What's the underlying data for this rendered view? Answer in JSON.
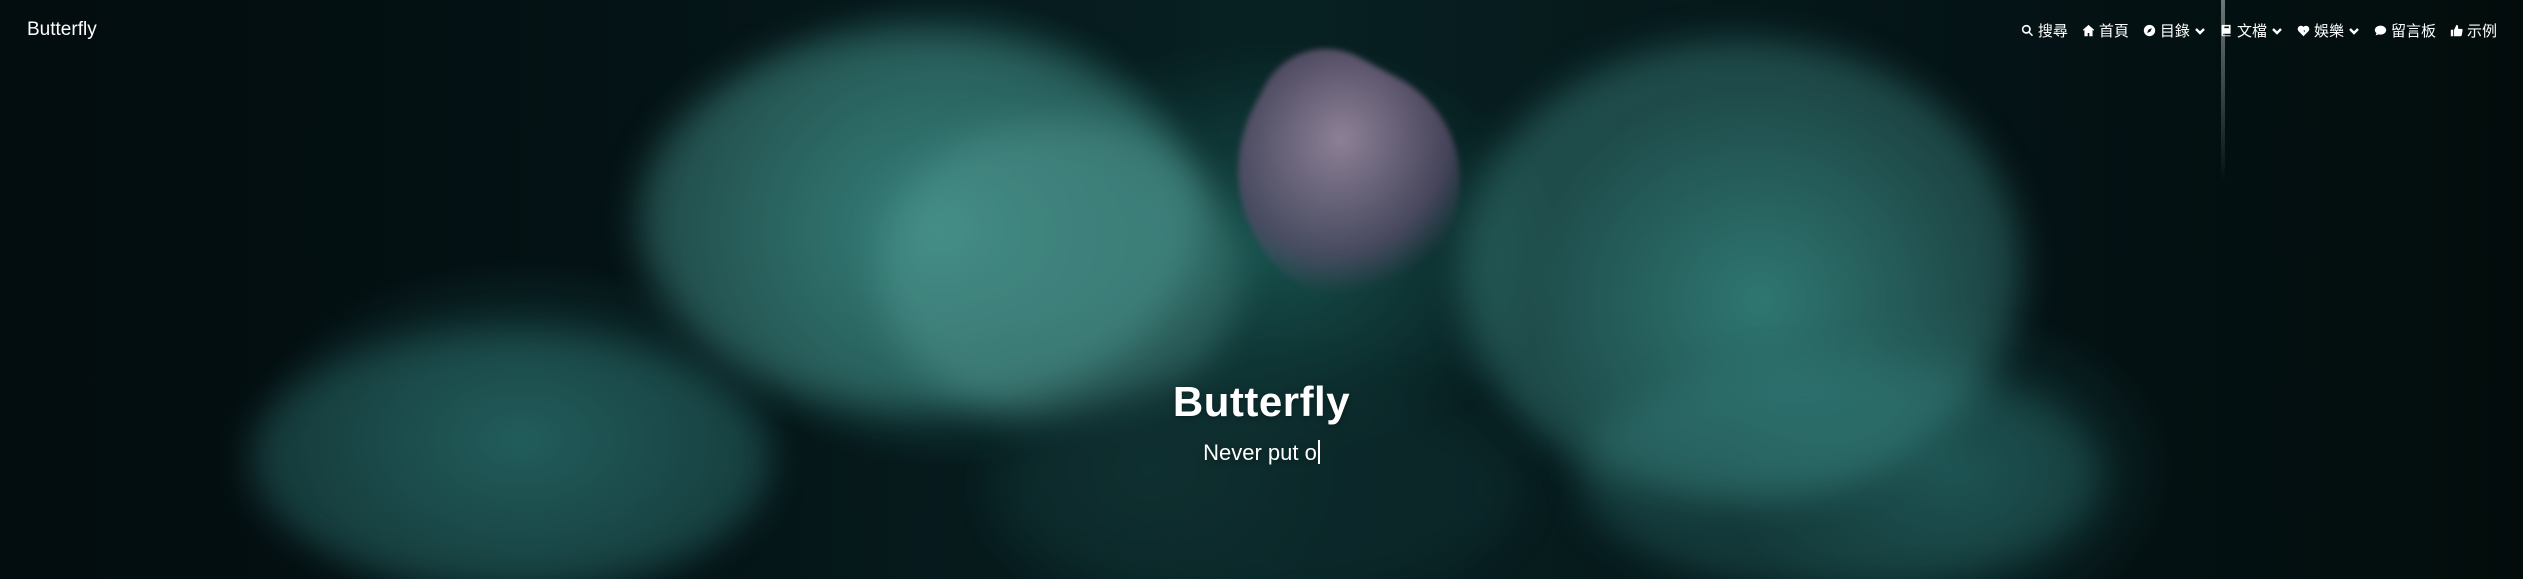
{
  "header": {
    "brand": "Butterfly",
    "menu": [
      {
        "label": "搜尋",
        "icon": "search-icon",
        "has_dropdown": false
      },
      {
        "label": "首頁",
        "icon": "home-icon",
        "has_dropdown": false
      },
      {
        "label": "目錄",
        "icon": "compass-icon",
        "has_dropdown": true
      },
      {
        "label": "文檔",
        "icon": "book-icon",
        "has_dropdown": true
      },
      {
        "label": "娛樂",
        "icon": "heartbeat-icon",
        "has_dropdown": true
      },
      {
        "label": "留言板",
        "icon": "comment-icon",
        "has_dropdown": false
      },
      {
        "label": "示例",
        "icon": "thumbs-up-icon",
        "has_dropdown": false
      }
    ]
  },
  "hero": {
    "title": "Butterfly",
    "subtitle": "Never put o"
  },
  "colors": {
    "text": "#ffffff",
    "smoke": "#3fb5a8",
    "background": "#061416"
  }
}
